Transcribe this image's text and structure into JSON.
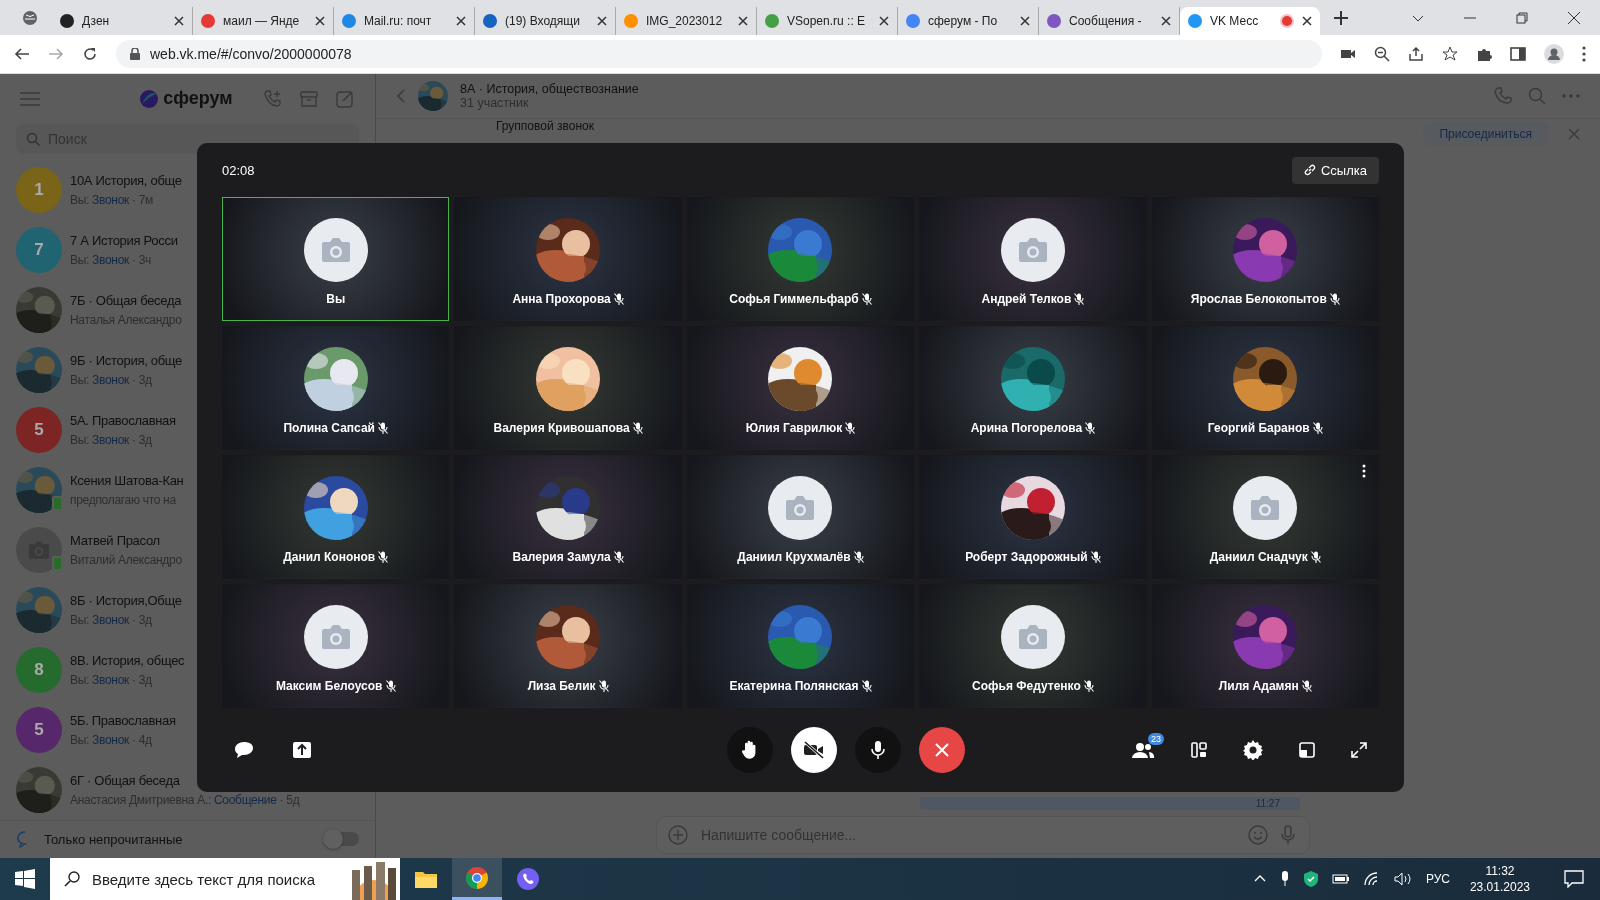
{
  "browser": {
    "tabs": [
      {
        "title": "Дзен",
        "selected": false
      },
      {
        "title": "маил — Янде",
        "selected": false
      },
      {
        "title": "Mail.ru: почт",
        "selected": false
      },
      {
        "title": "(19) Входящи",
        "selected": false
      },
      {
        "title": "IMG_2023012",
        "selected": false
      },
      {
        "title": "VSopen.ru :: E",
        "selected": false
      },
      {
        "title": "сферум - По",
        "selected": false
      },
      {
        "title": "Сообщения -",
        "selected": false
      },
      {
        "title": "VK Месс",
        "selected": true,
        "recording": true
      }
    ],
    "address": "web.vk.me/#/convo/2000000078"
  },
  "sidebar": {
    "logo": "сферум",
    "search": {
      "placeholder": "Поиск"
    },
    "chats": [
      {
        "title": "10А История, обще",
        "kind": "letter",
        "letter": "1",
        "color": "#7a6418",
        "sender": "Вы:",
        "action": "Звонок",
        "time": "· 7м",
        "online": false
      },
      {
        "title": "7 А История Росси",
        "kind": "letter",
        "letter": "7",
        "color": "#1f6470",
        "sender": "Вы:",
        "action": "Звонок",
        "time": "· 3ч",
        "online": false
      },
      {
        "title": "7Б · Общая беседа",
        "kind": "picture",
        "sender": "Наталья Александро",
        "online": false
      },
      {
        "title": "9Б · История, обще",
        "kind": "picture",
        "sender": "Вы:",
        "action": "Звонок",
        "time": "· 3д",
        "online": false
      },
      {
        "title": "5А. Православная",
        "kind": "letter",
        "letter": "5",
        "color": "#7d2424",
        "sender": "Вы:",
        "action": "Звонок",
        "time": "· 3д",
        "online": false
      },
      {
        "title": "Ксения Шатова-Кан",
        "kind": "picture",
        "sender": "предполагаю что на",
        "online": true
      },
      {
        "title": "Матвей Прасол",
        "kind": "camera",
        "sender": "Виталий Александро",
        "online": true
      },
      {
        "title": "8Б · История,Обще",
        "kind": "picture",
        "sender": "Вы:",
        "action": "Звонок",
        "time": "· 3д",
        "online": false
      },
      {
        "title": "8В. История, общес",
        "kind": "letter",
        "letter": "8",
        "color": "#266b2e",
        "sender": "Вы:",
        "action": "Звонок",
        "time": "· 3д",
        "online": false
      },
      {
        "title": "5Б. Православная",
        "kind": "letter",
        "letter": "5",
        "color": "#56276a",
        "sender": "Вы:",
        "action": "Звонок",
        "time": "· 4д",
        "online": false
      },
      {
        "title": "6Г · Общая беседа",
        "kind": "picture",
        "sender": "Анастасия Дмитриевна А.:",
        "action": "Сообщение",
        "time": "· 5д",
        "online": false
      }
    ],
    "unread_only": {
      "label": "Только непрочитанные",
      "on": false
    }
  },
  "chat": {
    "title": "8А · История, обществознание",
    "members": "31 участник",
    "group_call": "Групповой звонок",
    "join": "Присоединиться",
    "message_time": "11:27",
    "input": {
      "placeholder": "Напишите сообщение..."
    }
  },
  "call": {
    "timer": "02:08",
    "link_button": "Ссылка",
    "participants_count": "23",
    "camera_on": false,
    "participants": [
      {
        "name": "Вы",
        "kind": "camera",
        "speaking": true,
        "muted": false,
        "menu": false
      },
      {
        "name": "Анна Прохорова",
        "kind": "picture",
        "speaking": false,
        "muted": true,
        "menu": false
      },
      {
        "name": "Софья Гиммельфарб",
        "kind": "picture",
        "speaking": false,
        "muted": true,
        "menu": false
      },
      {
        "name": "Андрей Телков",
        "kind": "camera",
        "speaking": false,
        "muted": true,
        "menu": false
      },
      {
        "name": "Ярослав Белокопытов",
        "kind": "picture",
        "speaking": false,
        "muted": true,
        "menu": false
      },
      {
        "name": "Полина Сапсай",
        "kind": "picture",
        "speaking": false,
        "muted": true,
        "menu": false
      },
      {
        "name": "Валерия Кривошапова",
        "kind": "picture",
        "speaking": false,
        "muted": true,
        "menu": false
      },
      {
        "name": "Юлия Гаврилюк",
        "kind": "picture",
        "speaking": false,
        "muted": true,
        "menu": false
      },
      {
        "name": "Арина Погорелова",
        "kind": "picture",
        "speaking": false,
        "muted": true,
        "menu": false
      },
      {
        "name": "Георгий Баранов",
        "kind": "picture",
        "speaking": false,
        "muted": true,
        "menu": false
      },
      {
        "name": "Данил Кононов",
        "kind": "picture",
        "speaking": false,
        "muted": true,
        "menu": false
      },
      {
        "name": "Валерия Замула",
        "kind": "picture",
        "speaking": false,
        "muted": true,
        "menu": false
      },
      {
        "name": "Даниил Крухмалёв",
        "kind": "camera",
        "speaking": false,
        "muted": true,
        "menu": false
      },
      {
        "name": "Роберт Задорожный",
        "kind": "picture",
        "speaking": false,
        "muted": true,
        "menu": false
      },
      {
        "name": "Даниил Снадчук",
        "kind": "camera",
        "speaking": false,
        "muted": true,
        "menu": true
      },
      {
        "name": "Максим Белоусов",
        "kind": "camera",
        "speaking": false,
        "muted": true,
        "menu": false
      },
      {
        "name": "Лиза Белик",
        "kind": "picture",
        "speaking": false,
        "muted": true,
        "menu": false
      },
      {
        "name": "Екатерина Полянская",
        "kind": "picture",
        "speaking": false,
        "muted": true,
        "menu": false
      },
      {
        "name": "Софья Федутенко",
        "kind": "camera",
        "speaking": false,
        "muted": true,
        "menu": false
      },
      {
        "name": "Лиля Адамян",
        "kind": "picture",
        "speaking": false,
        "muted": true,
        "menu": false
      }
    ]
  },
  "taskbar": {
    "search": {
      "placeholder": "Введите здесь текст для поиска"
    },
    "language": "РУС",
    "time": "11:32",
    "date": "23.01.2023"
  }
}
